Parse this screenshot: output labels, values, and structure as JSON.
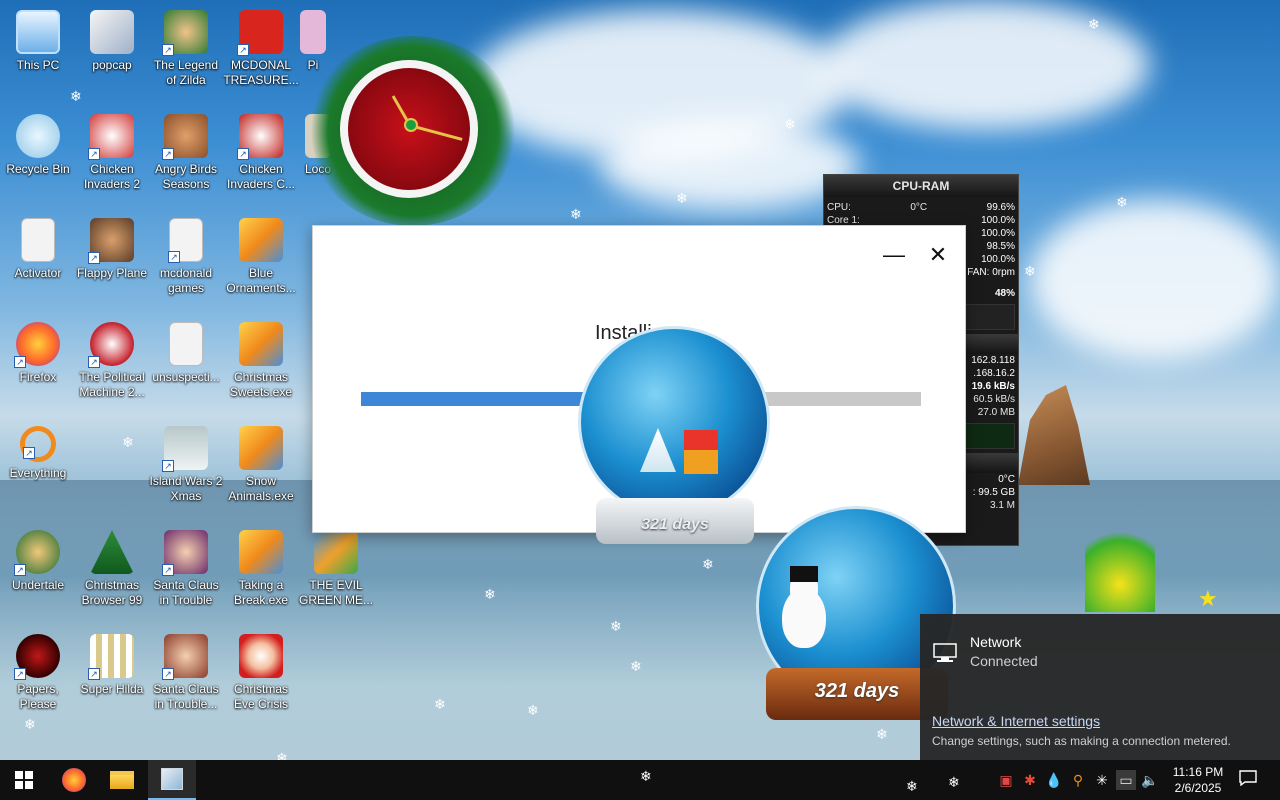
{
  "desktop": {
    "icons": [
      {
        "label": "This PC",
        "icon": "this-pc-icon"
      },
      {
        "label": "popcap",
        "icon": "popcap-icon"
      },
      {
        "label": "The Legend of Zilda",
        "icon": "zelda-game-icon"
      },
      {
        "label": "MCDONAL TREASURE...",
        "icon": "mcdonalds-game-icon"
      },
      {
        "label": "Recycle Bin",
        "icon": "recycle-bin-icon"
      },
      {
        "label": "Chicken Invaders 2",
        "icon": "chicken-invaders-icon"
      },
      {
        "label": "Angry Birds Seasons",
        "icon": "angry-birds-icon"
      },
      {
        "label": "Chicken Invaders C...",
        "icon": "chicken-invaders-christmas-icon"
      },
      {
        "label": "Activator",
        "icon": "file-icon"
      },
      {
        "label": "Flappy Plane",
        "icon": "flappy-plane-icon"
      },
      {
        "label": "mcdonald games",
        "icon": "folder-icon"
      },
      {
        "label": "Blue Ornaments...",
        "icon": "installer-icon"
      },
      {
        "label": "Firefox",
        "icon": "firefox-icon"
      },
      {
        "label": "The Political Machine 2...",
        "icon": "political-machine-icon"
      },
      {
        "label": "unsuspecti...",
        "icon": "file-icon"
      },
      {
        "label": "Christmas Sweets.exe",
        "icon": "installer-icon"
      },
      {
        "label": "Everything",
        "icon": "everything-search-icon"
      },
      {
        "label": "Island Wars 2 Xmas",
        "icon": "island-wars-icon"
      },
      {
        "label": "Snow Animals.exe",
        "icon": "installer-icon"
      },
      {
        "label": "Undertale",
        "icon": "undertale-icon"
      },
      {
        "label": "Christmas Browser 99",
        "icon": "christmas-tree-icon"
      },
      {
        "label": "Santa Claus in Trouble",
        "icon": "santa-game-icon"
      },
      {
        "label": "Taking a Break.exe",
        "icon": "installer-icon"
      },
      {
        "label": "THE EVIL GREEN ME...",
        "icon": "evil-green-icon"
      },
      {
        "label": "Papers, Please",
        "icon": "papers-please-icon"
      },
      {
        "label": "Super Hilda",
        "icon": "super-hilda-icon"
      },
      {
        "label": "Santa Claus in Trouble...",
        "icon": "santa-game-icon"
      },
      {
        "label": "Christmas Eve Crisis",
        "icon": "santa-face-icon"
      },
      {
        "label": "Pi",
        "icon": "partial-icon"
      },
      {
        "label": "Loco",
        "icon": "partial-icon"
      }
    ]
  },
  "cpu_gadget": {
    "title": "CPU-RAM",
    "rows": [
      {
        "label": "CPU:",
        "mid": "0°C",
        "value": "99.6%"
      },
      {
        "label": "Core 1:",
        "mid": "",
        "value": "100.0%"
      },
      {
        "label": "",
        "mid": "",
        "value": "100.0%"
      },
      {
        "label": "",
        "mid": "",
        "value": "98.5%"
      },
      {
        "label": "",
        "mid": "",
        "value": "100.0%"
      },
      {
        "label": "",
        "mid": "",
        "value": "FAN: 0rpm"
      },
      {
        "label": "",
        "mid": "",
        "value": "48%"
      }
    ],
    "net_rows": [
      "162.8.118",
      ".168.16.2",
      "19.6 kB/s",
      "60.5 kB/s",
      "27.0 MB"
    ],
    "disk_rows": [
      "0°C",
      ": 99.5 GB",
      "3.1 M"
    ]
  },
  "installer": {
    "status_text": "Installi",
    "progress_fraction": 0.42,
    "minimize_label": "—",
    "close_label": "✕"
  },
  "snow_globes": {
    "small_label": "321 days",
    "large_label": "321 days"
  },
  "network_flyout": {
    "network_name": "Network",
    "network_status": "Connected",
    "settings_link": "Network & Internet settings",
    "settings_desc": "Change settings, such as making a connection metered."
  },
  "taskbar": {
    "buttons": [
      {
        "name": "start-button",
        "icon": "windows-logo-icon"
      },
      {
        "name": "firefox-taskbar-button",
        "icon": "firefox-icon"
      },
      {
        "name": "file-explorer-taskbar-button",
        "icon": "folder-icon"
      },
      {
        "name": "installer-taskbar-button",
        "icon": "installer-icon"
      }
    ],
    "time": "11:16 PM",
    "date": "2/6/2025"
  },
  "colors": {
    "accent": "#3d86d8",
    "taskbar": "#101010",
    "flyout": "#262626"
  }
}
